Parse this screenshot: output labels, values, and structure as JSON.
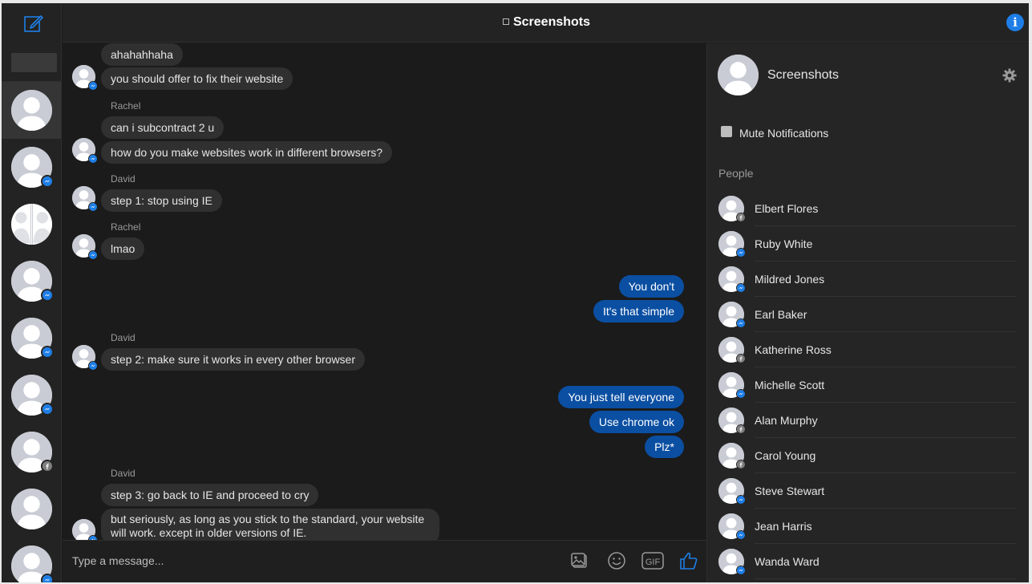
{
  "window": {
    "title": "Screenshots",
    "info_icon": "info-icon",
    "info_glyph": "i"
  },
  "rail": {
    "compose_icon": "compose-icon",
    "conversations": [
      {
        "active": true,
        "badge": "none"
      },
      {
        "active": false,
        "badge": "messenger"
      },
      {
        "active": false,
        "badge": "none",
        "variant": "group"
      },
      {
        "active": false,
        "badge": "messenger"
      },
      {
        "active": false,
        "badge": "messenger"
      },
      {
        "active": false,
        "badge": "messenger"
      },
      {
        "active": false,
        "badge": "facebook"
      },
      {
        "active": false,
        "badge": "none"
      },
      {
        "active": false,
        "badge": "messenger"
      }
    ]
  },
  "messages": [
    {
      "direction": "in",
      "text": "ahahahhaha"
    },
    {
      "direction": "in",
      "text": "you should offer to fix their website"
    },
    {
      "direction": "in",
      "sender": "Rachel",
      "text": "can i subcontract 2 u"
    },
    {
      "direction": "in",
      "text": "how do you make websites work in different browsers?"
    },
    {
      "direction": "in",
      "sender": "David",
      "text": "step 1: stop using IE"
    },
    {
      "direction": "in",
      "sender": "Rachel",
      "text": "lmao"
    },
    {
      "direction": "out",
      "text": "You don't"
    },
    {
      "direction": "out",
      "text": "It's that simple"
    },
    {
      "direction": "in",
      "sender": "David",
      "text": "step 2: make sure it works in every other browser"
    },
    {
      "direction": "out",
      "text": "You just tell everyone"
    },
    {
      "direction": "out",
      "text": "Use chrome ok"
    },
    {
      "direction": "out",
      "text": "Plz*"
    },
    {
      "direction": "in",
      "sender": "David",
      "text": "step 3: go back to IE and proceed to cry"
    },
    {
      "direction": "in",
      "text": "but seriously, as long as you stick to the standard, your website will work. except in older versions of IE."
    }
  ],
  "composer": {
    "placeholder": "Type a message...",
    "buttons": [
      "photo-icon",
      "emoji-icon",
      "gif-icon",
      "thumbs-up-icon"
    ],
    "gif_label": "GIF"
  },
  "panel": {
    "group_name": "Screenshots",
    "settings_icon": "gear-icon",
    "mute_label": "Mute Notifications",
    "mute_checked": false,
    "people_heading": "People",
    "people": [
      {
        "name": "Elbert Flores",
        "badge": "facebook"
      },
      {
        "name": "Ruby White",
        "badge": "messenger"
      },
      {
        "name": "Mildred Jones",
        "badge": "messenger"
      },
      {
        "name": "Earl Baker",
        "badge": "messenger"
      },
      {
        "name": "Katherine Ross",
        "badge": "facebook"
      },
      {
        "name": "Michelle Scott",
        "badge": "messenger"
      },
      {
        "name": "Alan Murphy",
        "badge": "facebook"
      },
      {
        "name": "Carol Young",
        "badge": "facebook"
      },
      {
        "name": "Steve Stewart",
        "badge": "messenger"
      },
      {
        "name": "Jean Harris",
        "badge": "messenger"
      },
      {
        "name": "Wanda Ward",
        "badge": "messenger"
      }
    ]
  },
  "colors": {
    "accent": "#1e7ee6",
    "outgoing_bubble": "#0b4fa2",
    "incoming_bubble": "#303030",
    "background": "#1b1b1b"
  }
}
